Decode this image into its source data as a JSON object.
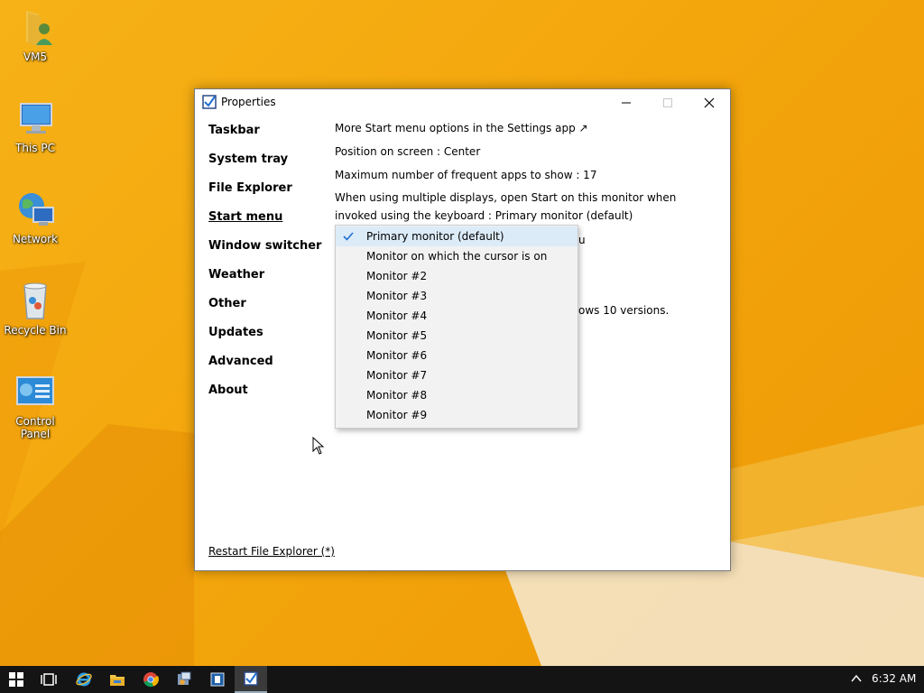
{
  "desktop": {
    "icons": [
      {
        "label": "VM5"
      },
      {
        "label": "This PC"
      },
      {
        "label": "Network"
      },
      {
        "label": "Recycle Bin"
      },
      {
        "label": "Control Panel"
      }
    ]
  },
  "window": {
    "title": "Properties",
    "sidebar": [
      {
        "label": "Taskbar"
      },
      {
        "label": "System tray"
      },
      {
        "label": "File Explorer"
      },
      {
        "label": "Start menu",
        "active": true
      },
      {
        "label": "Window switcher"
      },
      {
        "label": "Weather"
      },
      {
        "label": "Other"
      },
      {
        "label": "Updates"
      },
      {
        "label": "Advanced"
      },
      {
        "label": "About"
      }
    ],
    "options": {
      "settings_link": "More Start menu options in the Settings app ↗",
      "position": "Position on screen : Center",
      "max_apps": "Maximum number of frequent apps to show : 17",
      "multi_display": "When using multiple displays, open Start on this monitor when invoked using the keyboard : Primary monitor (default)",
      "partial_hidden_1": "u",
      "partial_hidden_2": "ows 10 versions."
    },
    "restart_link": "Restart File Explorer (*)"
  },
  "dropdown": {
    "selected": "Primary monitor (default)",
    "items": [
      "Primary monitor (default)",
      "Monitor on which the cursor is on",
      "Monitor #2",
      "Monitor #3",
      "Monitor #4",
      "Monitor #5",
      "Monitor #6",
      "Monitor #7",
      "Monitor #8",
      "Monitor #9"
    ]
  },
  "taskbar": {
    "apps": [
      "start-icon",
      "task-view-icon",
      "internet-explorer-icon",
      "file-explorer-icon",
      "chrome-icon",
      "app-icon-1",
      "app-icon-2",
      "properties-app-icon"
    ],
    "clock": "6:32 AM"
  },
  "colors": {
    "wallpaper": "#f2a306",
    "taskbar": "#141414",
    "dropdown_bg": "#f2f2f2",
    "selection": "#dcebf8",
    "check": "#1a6fd6"
  }
}
